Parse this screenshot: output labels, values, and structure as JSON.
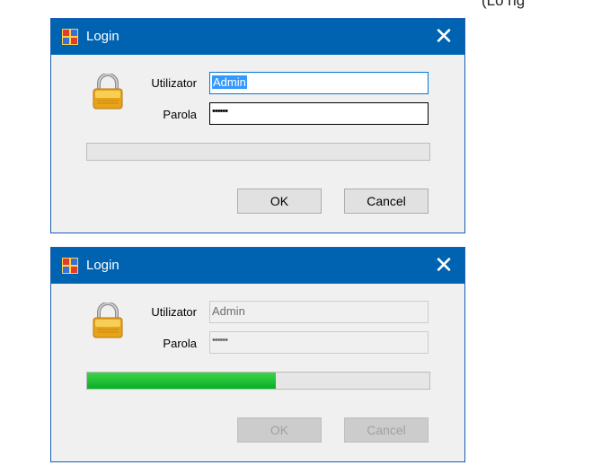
{
  "corner_text": "(Lo      ng",
  "dialog1": {
    "title": "Login",
    "close_glyph": "✕",
    "username_label": "Utilizator",
    "username_value": "Admin",
    "password_label": "Parola",
    "password_mask": "••••••",
    "progress": 0,
    "ok_label": "OK",
    "cancel_label": "Cancel"
  },
  "dialog2": {
    "title": "Login",
    "close_glyph": "✕",
    "username_label": "Utilizator",
    "username_value": "Admin",
    "password_label": "Parola",
    "password_mask": "••••••",
    "progress": 0.55,
    "ok_label": "OK",
    "cancel_label": "Cancel"
  },
  "colors": {
    "titlebar": "#0063b1",
    "progress_green": "#06b025",
    "selection": "#3399ff"
  }
}
